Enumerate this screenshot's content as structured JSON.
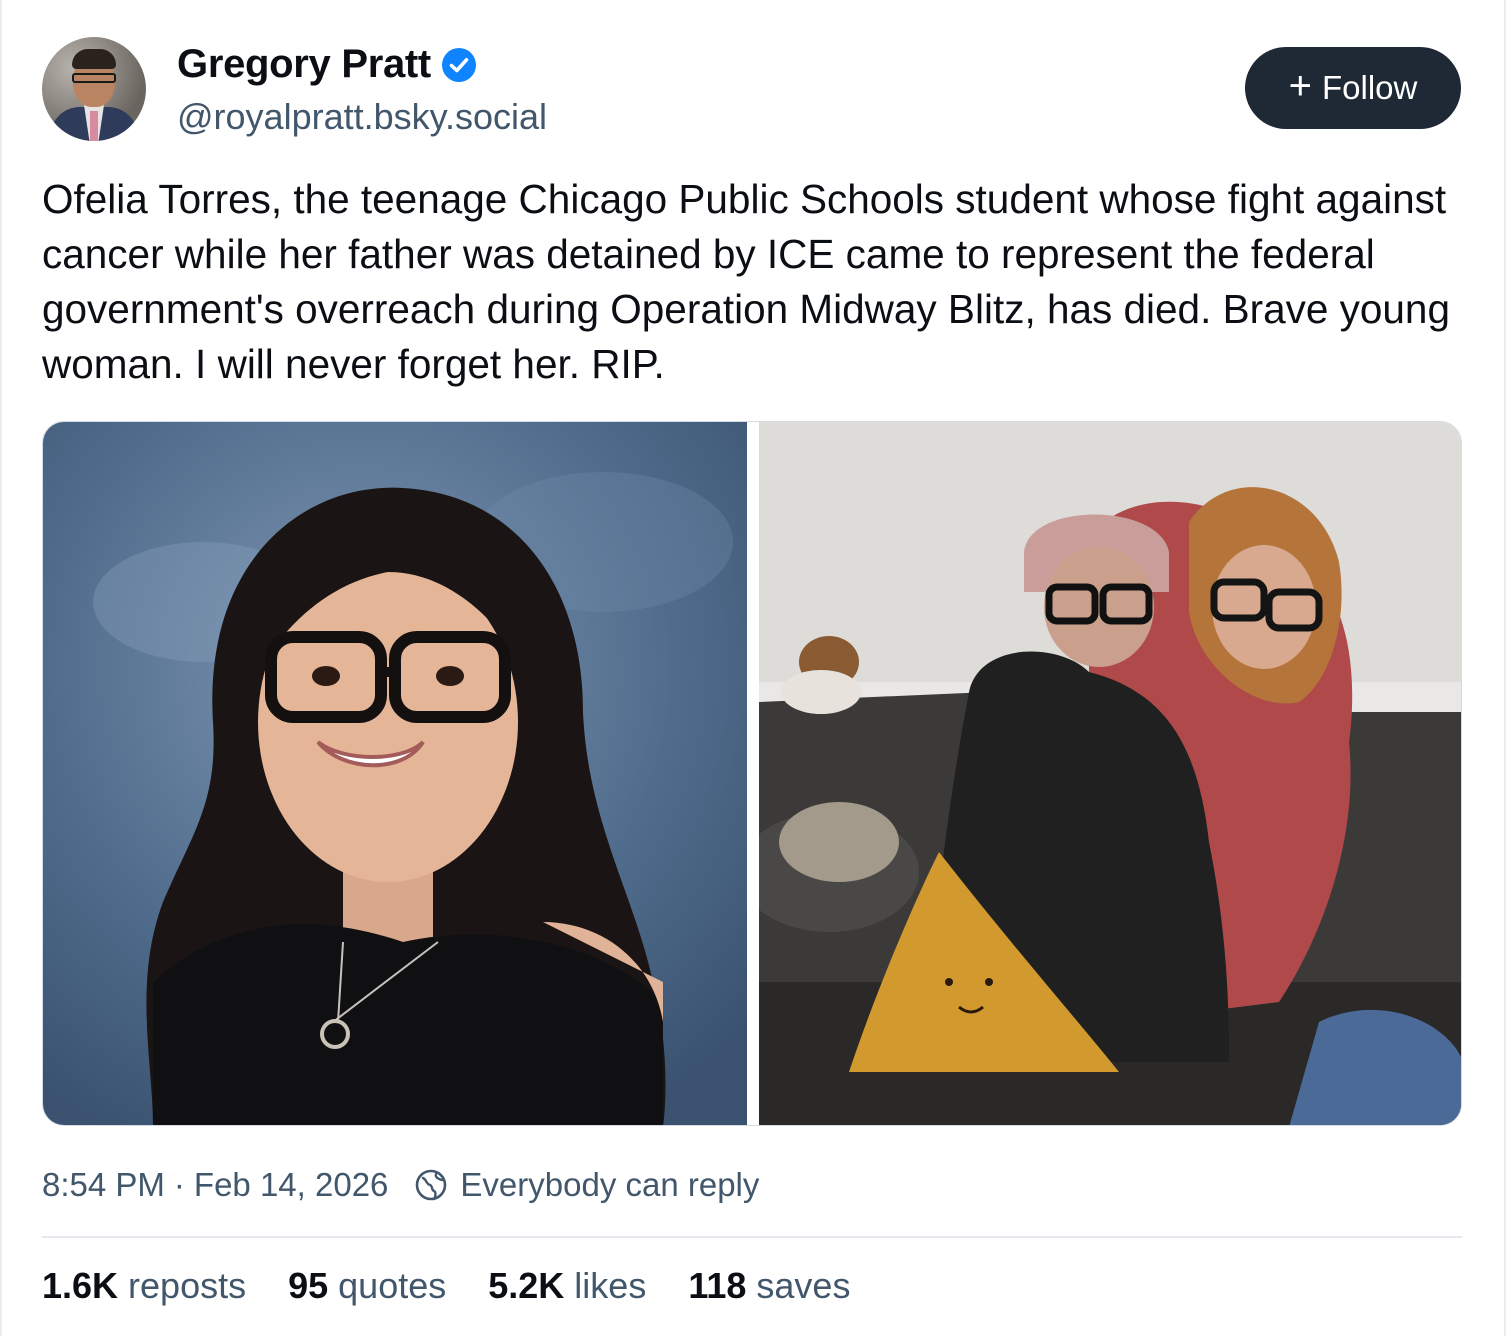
{
  "author": {
    "display_name": "Gregory Pratt",
    "handle": "@royalpratt.bsky.social",
    "verified_icon": "verified-check-icon",
    "avatar_alt": "Profile photo"
  },
  "follow_button": {
    "icon": "plus-icon",
    "label": "Follow"
  },
  "post": {
    "text": "Ofelia Torres, the teenage Chicago Public Schools student whose fight against cancer while her father was detained by ICE came to represent the federal government's overreach during Operation Midway Blitz, has died. Brave young woman. I will never forget her. RIP.",
    "images": [
      {
        "description": "Portrait photo"
      },
      {
        "description": "Photo on couch"
      }
    ]
  },
  "meta": {
    "time": "8:54 PM",
    "separator": "·",
    "date": "Feb 14, 2026",
    "reply_icon": "globe-icon",
    "reply_setting": "Everybody can reply"
  },
  "stats": {
    "reposts": {
      "count": "1.6K",
      "label": "reposts"
    },
    "quotes": {
      "count": "95",
      "label": "quotes"
    },
    "likes": {
      "count": "5.2K",
      "label": "likes"
    },
    "saves": {
      "count": "118",
      "label": "saves"
    }
  },
  "colors": {
    "text_primary": "#0b0f14",
    "text_secondary": "#42576c",
    "follow_bg": "#1e2935",
    "verified_blue": "#1083fe"
  }
}
